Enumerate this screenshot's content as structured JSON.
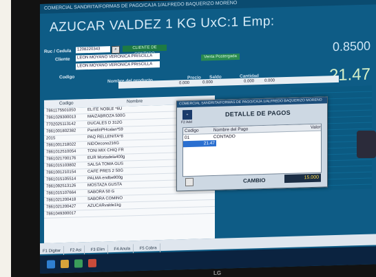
{
  "window": {
    "title": "COMERCIAL SANDRITA/FORMAS DE PAGO/CAJA 1/ALFREDO BAQUERIZO MORENO"
  },
  "product": {
    "title": "AZUCAR VALDEZ 1 KG UxC:1 Emp:",
    "price": "0.8500",
    "total": "21.47"
  },
  "customer": {
    "id_label": "Ruc / Cedula",
    "id_value": "1208220343",
    "client_label": "Cliente",
    "client_value": "LEON MOYANO VERONICA PRISCILLA",
    "client_value2": "LEON MOYANO VERONICA PRISCILLA",
    "code_label": "Codigo",
    "product_name_label": "Nombre del producto",
    "price_label": "Precio",
    "balance_label": "Saldo",
    "qty_label": "Cantidad",
    "status_badge": "CLIENTE DE CONTADO",
    "sales_badge": "Venta Postergada"
  },
  "summary": {
    "price": "0.000",
    "balance": "0.000",
    "qty": "0.000",
    "extra": "0.000"
  },
  "grid": {
    "headers": [
      "Codigo",
      "Nombre"
    ],
    "rows": [
      [
        "7861175501050",
        "ELITE NOBLE *6U"
      ],
      [
        "7861029300013",
        "MAIZABROZA 500G"
      ],
      [
        "7702025113142",
        "DUCALES D 312G"
      ],
      [
        "7861001802382",
        "PanelinPHcalan*59"
      ],
      [
        "2015",
        "PAQ RELLENITA*8"
      ],
      [
        "7861001218022",
        "NIDOecono216G"
      ],
      [
        "7861012510054",
        "TONI MIX CHIQ FR"
      ],
      [
        "7861021700176",
        "EUR Mortadela400g"
      ],
      [
        "7861015103802",
        "SALSA TOMA GUS"
      ],
      [
        "7861001210154",
        "CAFE PRES 2 50G"
      ],
      [
        "7861015105514",
        "PALMA endbe900g"
      ],
      [
        "7861092513126",
        "MOSTAZA GUSTA"
      ],
      [
        "7861015107664",
        "SABORA 50 G"
      ],
      [
        "7861021200418",
        "SABORA COMINO"
      ],
      [
        "7861021200427",
        "AZUCARvalde1kg"
      ],
      [
        "7861049300017",
        ""
      ]
    ]
  },
  "dialog": {
    "title": "COMERCIAL SANDRITA/FORMAS DE PAGO/CAJA 1/ALFREDO BAQUERIZO MORENO",
    "heading": "DETALLE DE PAGOS",
    "f2_label": "F2 Add",
    "table_headers": [
      "Codigo",
      "Nombre del Pago",
      "Valor"
    ],
    "rows": [
      [
        "01",
        "CONTADO",
        "21.47"
      ]
    ],
    "change_label": "CAMBIO",
    "change_value": "15.000"
  },
  "tabs": [
    "F1 Digitar",
    "F2 Asi",
    "F3 Elim",
    "F4 Anula",
    "F5 Cobra"
  ],
  "taskbar": {
    "brand": "LG"
  },
  "colors": {
    "screen_bg": "#0e5c86",
    "accent_green": "#1e7a43",
    "dialog_bg": "#cdd8e3"
  }
}
